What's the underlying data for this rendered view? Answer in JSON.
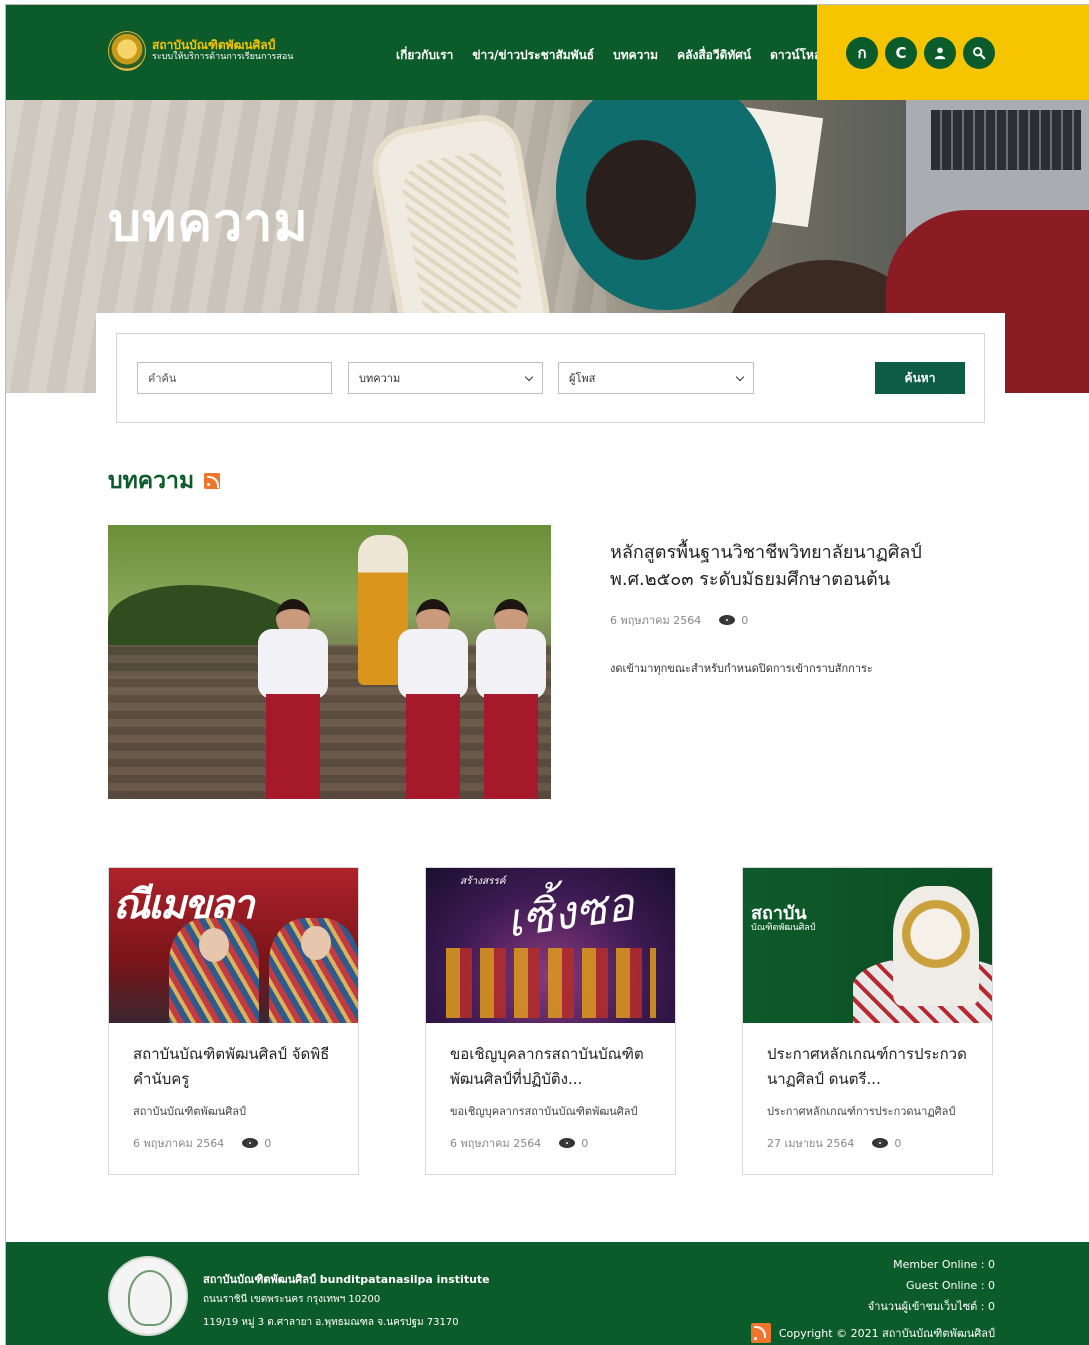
{
  "site": {
    "logo_title": "สถาบันบัณฑิตพัฒนศิลป์",
    "logo_subtitle": "ระบบให้บริการด้านการเรียนการสอน"
  },
  "nav": [
    "เกี่ยวกับเรา",
    "ข่าว/ข่าวประชาสัมพันธ์",
    "บทความ",
    "คลังสื่อวีดิทัศน์",
    "ดาวน์โหลด"
  ],
  "circle_buttons": {
    "font_small": "ก",
    "font_reset": "C",
    "user_icon": "user-icon",
    "search_icon": "search-icon"
  },
  "hero": {
    "title": "บทความ"
  },
  "search": {
    "keyword_placeholder": "คำค้น",
    "category_value": "บทความ",
    "author_value": "ผู้โพส",
    "button_label": "ค้นหา"
  },
  "section": {
    "title": "บทความ"
  },
  "featured": {
    "title": "หลักสูตรพื้นฐานวิชาชีพวิทยาลัยนาฏศิลป์ พ.ศ.๒๕๐๓ ระดับมัธยมศึกษาตอนต้น",
    "date": "6 พฤษภาคม 2564",
    "views": "0",
    "description": "งดเข้ามาทุกขณะสำหรับกำหนดปิดการเข้ากราบสักการะ"
  },
  "cards": [
    {
      "title": "สถาบันบัณฑิตพัฒนศิลป์ จัดพิธีคำนับครู",
      "subtitle": "สถาบันบัณฑิตพัฒนศิลป์",
      "date": "6 พฤษภาคม 2564",
      "views": "0",
      "image_text": "ณีเมขลา"
    },
    {
      "title": "ขอเชิญบุคลากรสถาบันบัณฑิตพัฒนศิลป์ที่ปฏิบัติง...",
      "subtitle": "ขอเชิญบุคลากรสถาบันบัณฑิตพัฒนศิลป์",
      "date": "6 พฤษภาคม 2564",
      "views": "0",
      "image_text": "เซิ้งซอ",
      "image_small": "สร้างสรรค์"
    },
    {
      "title": "ประกาศหลักเกณฑ์การประกวดนาฏศิลป์ ดนตรี...",
      "subtitle": "ประกาศหลักเกณฑ์การประกวดนาฏศิลป์",
      "date": "27 เมษายน 2564",
      "views": "0",
      "image_text": "สถาบัน",
      "image_text2": "บัณฑิตพัฒนศิลป์"
    }
  ],
  "footer": {
    "name": "สถาบันบัณฑิตพัฒนศิลป์ bunditpatanasilpa institute",
    "address1": "ถนนราชินี เขตพระนคร กรุงเทพฯ 10200",
    "address2": "119/19 หมู่ 3 ต.ศาลายา อ.พุทธมณฑล จ.นครปฐม 73170",
    "member_online": "Member Online : 0",
    "guest_online": "Guest Online : 0",
    "visitors": "จำนวนผู้เข้าชมเว็บไซต์ : 0",
    "copyright": "Copyright © 2021 สถาบันบัณฑิตพัฒนศิลป์"
  },
  "colors": {
    "primary_green": "#0c5b2a",
    "accent_yellow": "#f6c500",
    "button_green": "#0e5b46",
    "rss_orange": "#f0742b"
  }
}
